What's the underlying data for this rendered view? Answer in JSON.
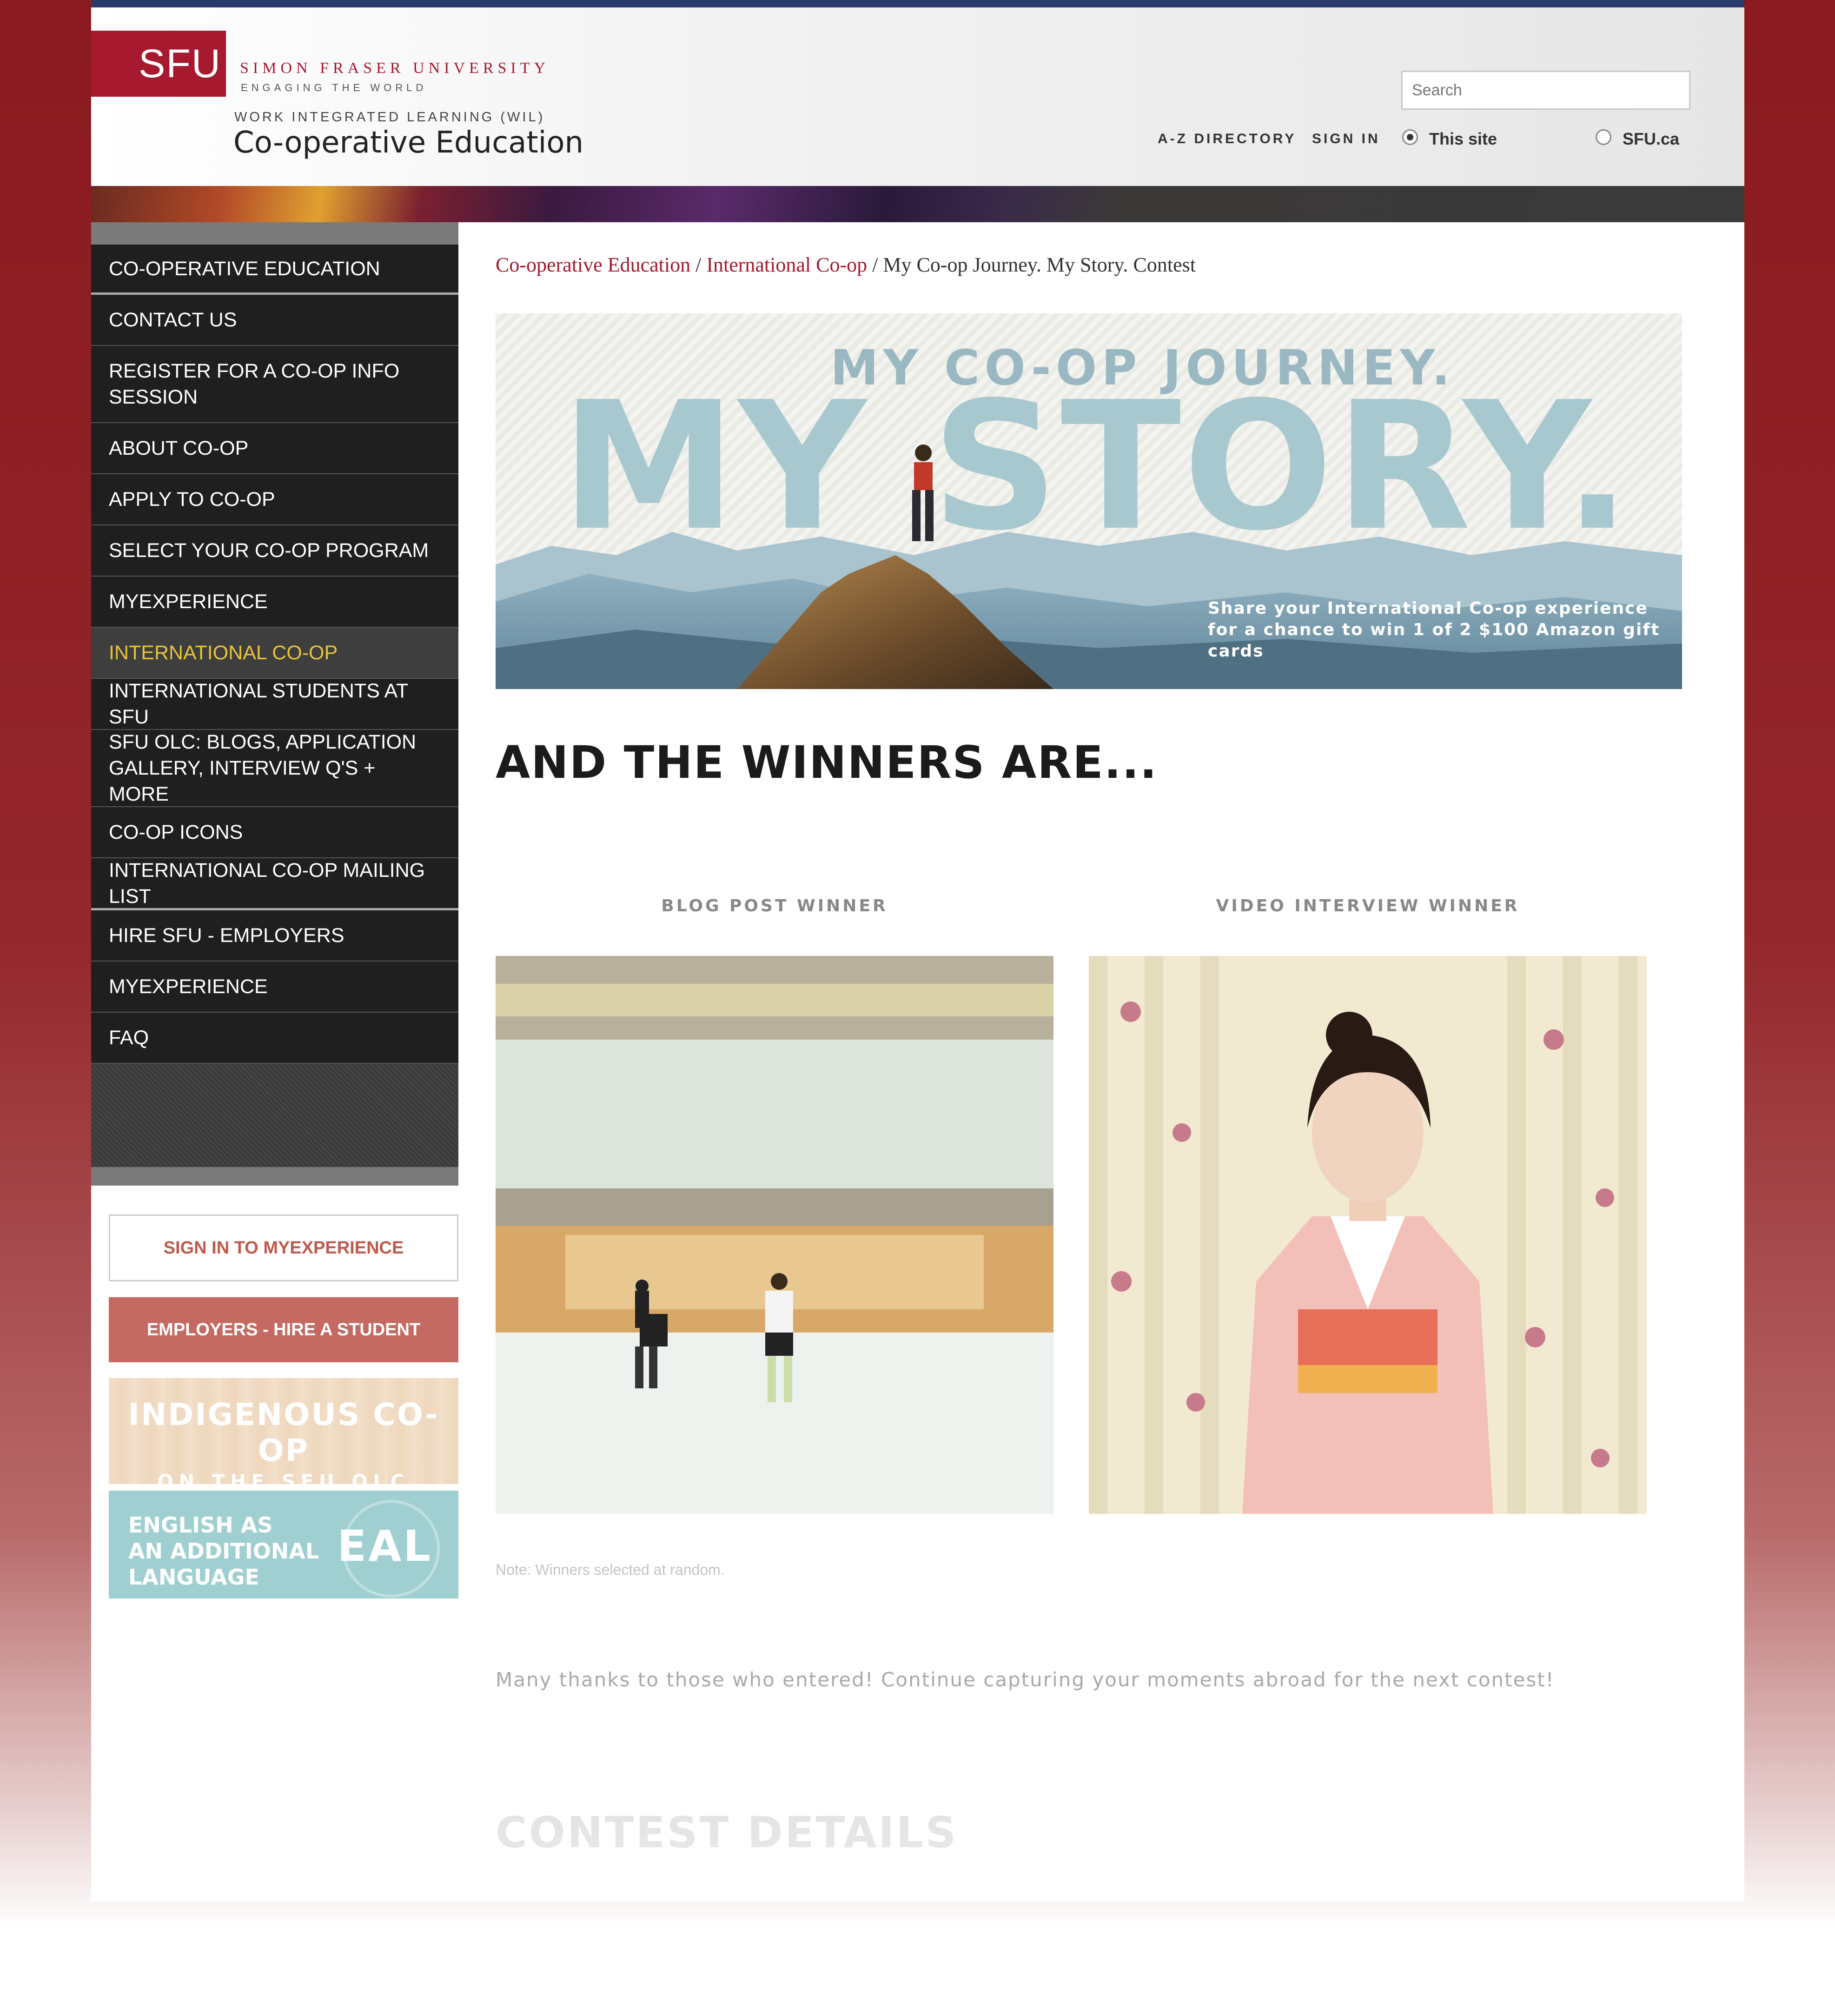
{
  "header": {
    "logo": "SFU",
    "university_name": "SIMON FRASER UNIVERSITY",
    "tagline": "ENGAGING THE WORLD",
    "program_line": "WORK INTEGRATED LEARNING (WIL)",
    "site_title": "Co-operative Education",
    "search_placeholder": "Search",
    "links": [
      "A-Z DIRECTORY",
      "SIGN IN"
    ],
    "scope_options": [
      "This site",
      "SFU.ca"
    ],
    "scope_selected": "This site"
  },
  "sidebar": {
    "items": [
      {
        "label": "CO-OPERATIVE EDUCATION",
        "active": false
      },
      {
        "label": "CONTACT US",
        "active": false
      },
      {
        "label": "REGISTER FOR A CO-OP INFO SESSION",
        "active": false
      },
      {
        "label": "ABOUT CO-OP",
        "active": false
      },
      {
        "label": "APPLY TO CO-OP",
        "active": false
      },
      {
        "label": "SELECT YOUR CO-OP PROGRAM",
        "active": false
      },
      {
        "label": "MYEXPERIENCE",
        "active": false
      },
      {
        "label": "INTERNATIONAL CO-OP",
        "active": true
      },
      {
        "label": "INTERNATIONAL STUDENTS AT SFU",
        "active": false
      },
      {
        "label": "SFU OLC: BLOGS, APPLICATION GALLERY, INTERVIEW Q'S + MORE",
        "active": false
      },
      {
        "label": "CO-OP ICONS",
        "active": false
      },
      {
        "label": "INTERNATIONAL CO-OP MAILING LIST",
        "active": false
      },
      {
        "label": "HIRE SFU - EMPLOYERS",
        "active": false
      },
      {
        "label": "MYEXPERIENCE",
        "active": false
      },
      {
        "label": "FAQ",
        "active": false
      }
    ],
    "signin_button": "SIGN IN TO MYEXPERIENCE",
    "employers_button": "EMPLOYERS - HIRE A STUDENT",
    "promo_indigenous": {
      "line1": "INDIGENOUS CO-OP",
      "line2": "ON THE SFU OLC"
    },
    "promo_eal": {
      "text": "ENGLISH AS\nAN ADDITIONAL\nLANGUAGE",
      "abbr": "EAL"
    }
  },
  "breadcrumb": {
    "items": [
      "Co-operative Education",
      "International Co-op"
    ],
    "current": "My Co-op Journey. My Story. Contest"
  },
  "hero": {
    "line1": "MY CO-OP JOURNEY.",
    "line2": "MY STORY.",
    "caption": "Share your International Co-op experience\nfor a chance to win 1 of 2 $100 Amazon gift cards"
  },
  "main": {
    "winners_heading": "AND THE WINNERS ARE...",
    "blog_label": "BLOG POST WINNER",
    "video_label": "VIDEO INTERVIEW WINNER",
    "note": "Note: Winners selected at random.",
    "thanks": "Many thanks to those who entered! Continue capturing your moments abroad for the next contest!",
    "contest_heading": "CONTEST DETAILS"
  },
  "colors": {
    "sfu_red": "#a6192e",
    "nav_bg": "#1f1f1f",
    "nav_active_text": "#e8c33a",
    "employers_btn": "#c46a62"
  }
}
